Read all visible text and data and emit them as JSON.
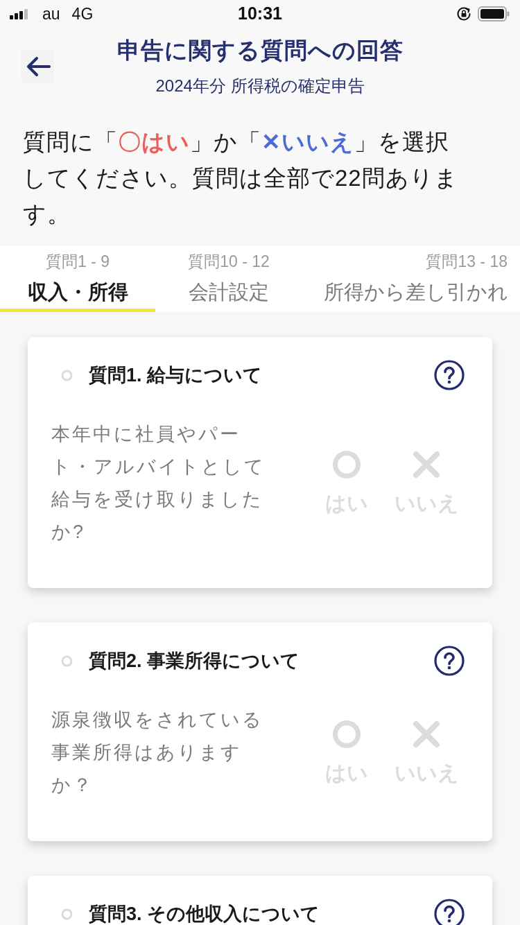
{
  "status_bar": {
    "carrier": "au",
    "network": "4G",
    "time": "10:31"
  },
  "header": {
    "title": "申告に関する質問への回答",
    "subtitle": "2024年分 所得税の確定申告"
  },
  "instructions": [
    {
      "kind": "plain",
      "text": "質問に「"
    },
    {
      "kind": "yes",
      "text": "〇はい"
    },
    {
      "kind": "plain",
      "text": "」か「"
    },
    {
      "kind": "no",
      "text": "✕いいえ"
    },
    {
      "kind": "plain",
      "text": "」を選択してください。質問は全部で22問あります。"
    }
  ],
  "tabs": [
    {
      "range": "質問1 - 9",
      "label": "収入・所得",
      "selected": true
    },
    {
      "range": "質問10 - 12",
      "label": "会計設定",
      "selected": false
    },
    {
      "range": "質問13 - 18",
      "label": "所得から差し引かれ",
      "selected": false
    }
  ],
  "questions": [
    {
      "title": "質問1. 給与について",
      "text": "本年中に社員やパート・アルバイトとして給与を受け取りましたか?",
      "options": [
        {
          "kind": "yes",
          "label": "はい",
          "selected": false
        },
        {
          "kind": "no",
          "label": "いいえ",
          "selected": false
        }
      ]
    },
    {
      "title": "質問2. 事業所得について",
      "text": "源泉徴収をされている事業所得はありますか？",
      "options": [
        {
          "kind": "yes",
          "label": "はい",
          "selected": false
        },
        {
          "kind": "no",
          "label": "いいえ",
          "selected": false
        }
      ]
    },
    {
      "title": "質問3. その他収入について"
    }
  ]
}
